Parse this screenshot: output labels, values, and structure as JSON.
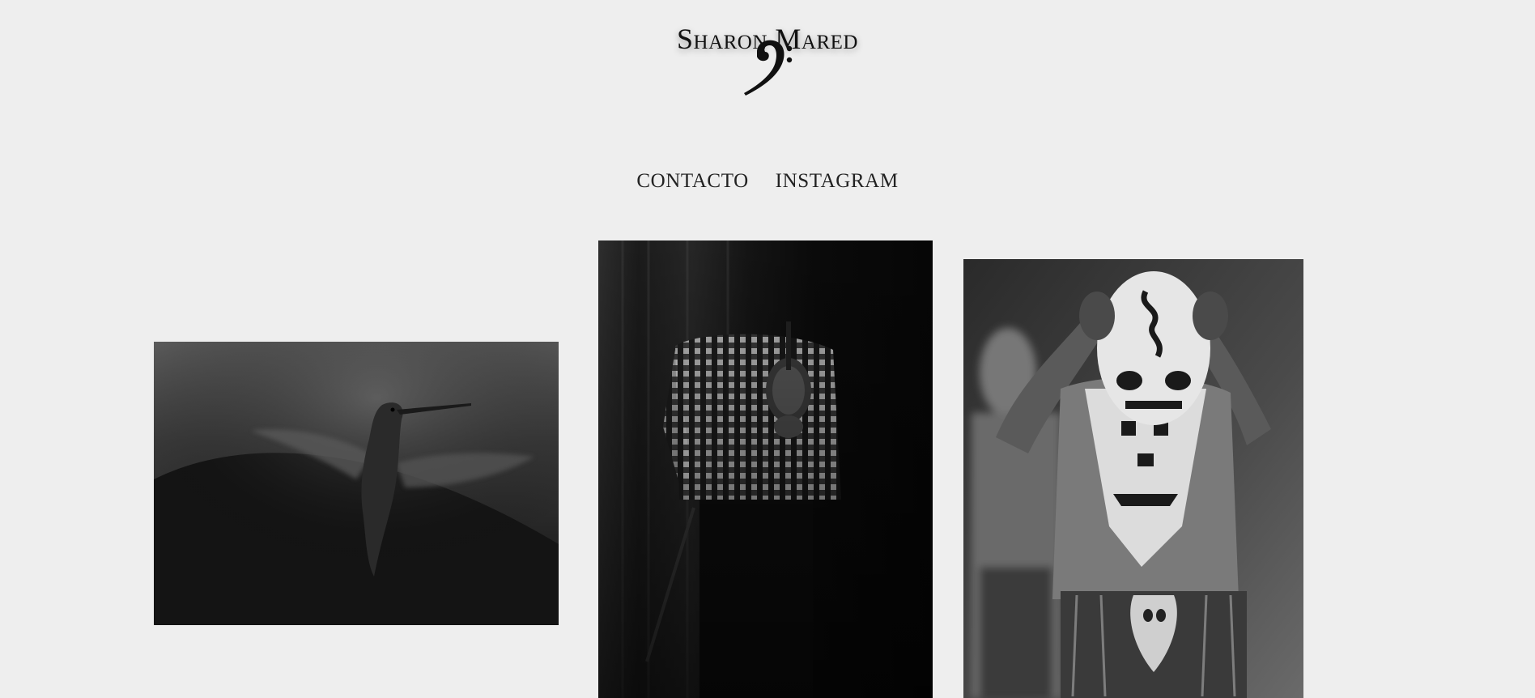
{
  "site": {
    "title": "Sharon Mared",
    "logo_icon": "bass-clef-icon"
  },
  "nav": {
    "items": [
      {
        "label": "CONTACTO"
      },
      {
        "label": "INSTAGRAM"
      }
    ]
  },
  "gallery": {
    "photos": [
      {
        "subject": "hummingbird-photo",
        "tone": "black-and-white"
      },
      {
        "subject": "violinist-photo",
        "tone": "black-and-white"
      },
      {
        "subject": "masked-dancer-photo",
        "tone": "black-and-white"
      }
    ]
  },
  "colors": {
    "background": "#eeeeee",
    "text": "#222222"
  }
}
